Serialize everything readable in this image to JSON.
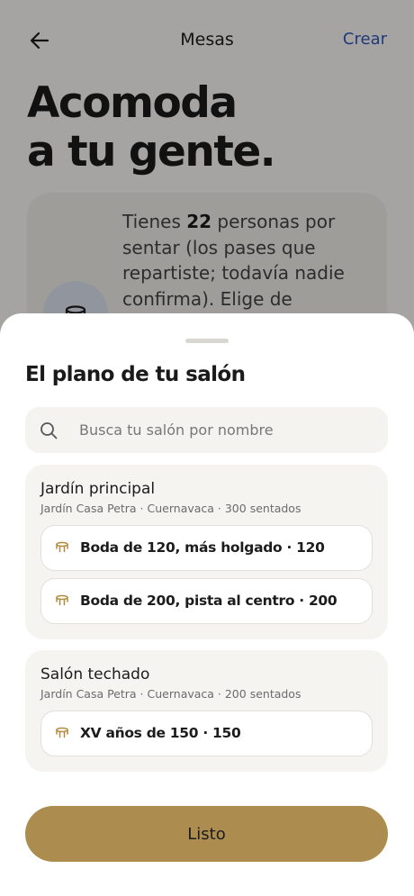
{
  "header": {
    "title": "Mesas",
    "create_label": "Crear"
  },
  "hero": {
    "line1": "Acomoda",
    "line2": "a tu gente."
  },
  "info_card": {
    "pre": "Tienes ",
    "count": "22",
    "post": " personas por sentar (los pases que repartiste; todavía nadie confirma). Elige de"
  },
  "sheet": {
    "title": "El plano de tu salón",
    "search_placeholder": "Busca tu salón por nombre",
    "search_value": "",
    "venues": [
      {
        "name": "Jardín principal",
        "meta": "Jardín Casa Petra · Cuernavaca · 300 sentados",
        "layouts": [
          {
            "label": "Boda de 120, más holgado · 120"
          },
          {
            "label": "Boda de 200, pista al centro · 200"
          }
        ]
      },
      {
        "name": "Salón techado",
        "meta": "Jardín Casa Petra · Cuernavaca · 200 sentados",
        "layouts": [
          {
            "label": "XV años de 150 · 150"
          }
        ]
      }
    ],
    "done_label": "Listo"
  },
  "colors": {
    "accent_gold": "#ad8d4f",
    "link_blue": "#3457b8",
    "icon_gold": "#b08a3e"
  },
  "icons": {
    "back": "arrow-left-icon",
    "search": "search-icon",
    "layout": "table-icon",
    "avatar": "chair-icon"
  }
}
